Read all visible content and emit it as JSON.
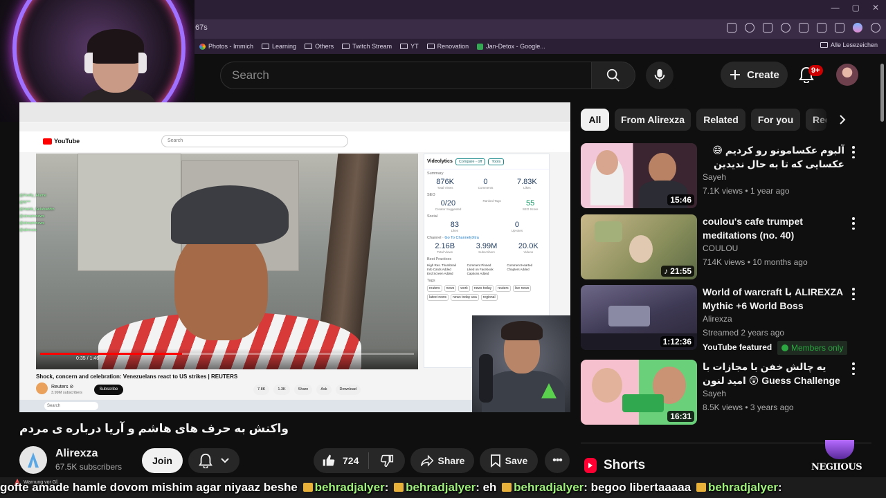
{
  "browser": {
    "url_fragment": "67s",
    "bookmarks": [
      {
        "label": "Photos - Immich",
        "icon": "color-dot-icon"
      },
      {
        "label": "Learning",
        "icon": "folder-icon"
      },
      {
        "label": "Others",
        "icon": "folder-icon"
      },
      {
        "label": "Twitch Stream",
        "icon": "folder-icon"
      },
      {
        "label": "YT",
        "icon": "folder-icon"
      },
      {
        "label": "Renovation",
        "icon": "folder-icon"
      },
      {
        "label": "Jan-Detox - Google...",
        "icon": "green-doc-icon"
      }
    ],
    "all_bookmarks": "Alle Lesezeichen"
  },
  "header": {
    "search_placeholder": "Search",
    "create_label": "Create",
    "notifications_badge": "9+"
  },
  "player_content": {
    "inner_search": "Search",
    "inner_brand": "YouTube",
    "inner_time": "0:35 / 1:46",
    "inner_progress": 0.38,
    "inner_title": "Shock, concern and celebration: Venezuelans react to US strikes | REUTERS",
    "inner_channel": "Reuters ⊘",
    "inner_subs": "3.99M subscribers",
    "inner_subscribe": "Subscribe",
    "inner_actions": [
      "7.8K",
      "1.3K",
      "Share",
      "Ask",
      "Download"
    ],
    "inner_taskbar_search": "Search",
    "videolytics": {
      "title": "Videolytics",
      "compare": "Compare - off",
      "tools": "Tools",
      "summary_label": "Summary",
      "summary": [
        {
          "value": "876K",
          "label": "Total Views"
        },
        {
          "value": "0",
          "label": "Comments"
        },
        {
          "value": "7.83K",
          "label": "Likes"
        }
      ],
      "seo_label": "SEO",
      "seo": [
        {
          "value": "0/20",
          "label": "Creator Suggested"
        },
        {
          "value": "",
          "label": "Ranked Tags"
        },
        {
          "value": "55",
          "label": "SEO Score"
        }
      ],
      "social_label": "Social",
      "social": [
        {
          "value": "83",
          "label": "Likes"
        },
        {
          "value": "0",
          "label": "Upvotes"
        }
      ],
      "channel_label": "Channel",
      "channel_link": "Go To ChannelyXtra",
      "channel": [
        {
          "value": "2.16B",
          "label": "Total Views"
        },
        {
          "value": "3.99M",
          "label": "Subscribers"
        },
        {
          "value": "20.0K",
          "label": "Videos"
        }
      ],
      "best_practices_label": "Best Practices",
      "best_practices": [
        "High Res. Thumbnail",
        "Comment Pinned",
        "Comment Hearted",
        "Info Cards Added",
        "Liked on Facebook",
        "Chapters Added",
        "End Screen Added",
        "Captions Added"
      ],
      "tags_label": "Tags",
      "tags": [
        "reuters",
        "news",
        "work",
        "news today",
        "reuters",
        "live news",
        "latest news",
        "news today usa",
        "regional"
      ]
    },
    "chat_lines": [
      "@Firefly_Flame",
      "@N***",
      "@Habib_Selahaddin",
      "@streamviews",
      "@streamviews",
      "@alirexza"
    ]
  },
  "video": {
    "title": "واکنش به حرف های هاشم و آریا درباره ی مردم",
    "channel": "Alirexza",
    "subscribers": "67.5K subscribers",
    "join_label": "Join",
    "likes": "724",
    "share_label": "Share",
    "save_label": "Save"
  },
  "chips": [
    "All",
    "From Alirexza",
    "Related",
    "For you",
    "Recently uploaded"
  ],
  "recommendations": [
    {
      "title": "آلبوم عکسامونو رو کردیم 😅 عکسایی که تا به حال ندیدین",
      "rtl": true,
      "channel": "Sayeh",
      "meta": "7.1K views • 1 year ago",
      "duration": "15:46"
    },
    {
      "title": "coulou's cafe trumpet meditations (no. 40)",
      "rtl": false,
      "channel": "COULOU",
      "meta": "714K views • 10 months ago",
      "duration": "♪ 21:55"
    },
    {
      "title": "World of warcraft با ALIREXZA Mythic +6 World Boss",
      "rtl": false,
      "channel": "Alirexza",
      "meta": "Streamed 2 years ago",
      "duration": "1:12:36",
      "featured": "YouTube featured",
      "members": "Members only"
    },
    {
      "title": "یه چالش خفن با مجازات با امید لنون 😲 Guess Challenge x Omid ...",
      "rtl": false,
      "channel": "Sayeh",
      "meta": "8.5K views • 3 years ago",
      "duration": "16:31"
    }
  ],
  "shorts_label": "Shorts",
  "overlay": {
    "brand": "NEGIIOUS",
    "warning": "Warnung vor Gl...",
    "ticker": [
      {
        "kind": "text",
        "v": "gofte amade hamle dovom mishim agar niyaaz beshe "
      },
      {
        "kind": "user",
        "v": "behradjalyer"
      },
      {
        "kind": "text",
        "v": ": "
      },
      {
        "kind": "user",
        "v": "behradjalyer"
      },
      {
        "kind": "text",
        "v": ": eh "
      },
      {
        "kind": "user",
        "v": "behradjalyer"
      },
      {
        "kind": "text",
        "v": ": begoo libertaaaaa "
      },
      {
        "kind": "user",
        "v": "behradjalyer"
      },
      {
        "kind": "text",
        "v": ":"
      }
    ]
  },
  "colors": {
    "background": "#0f0f0f",
    "accent_red": "#ff0000",
    "members_green": "#2ba640",
    "chat_user_green": "#9ef07a"
  }
}
